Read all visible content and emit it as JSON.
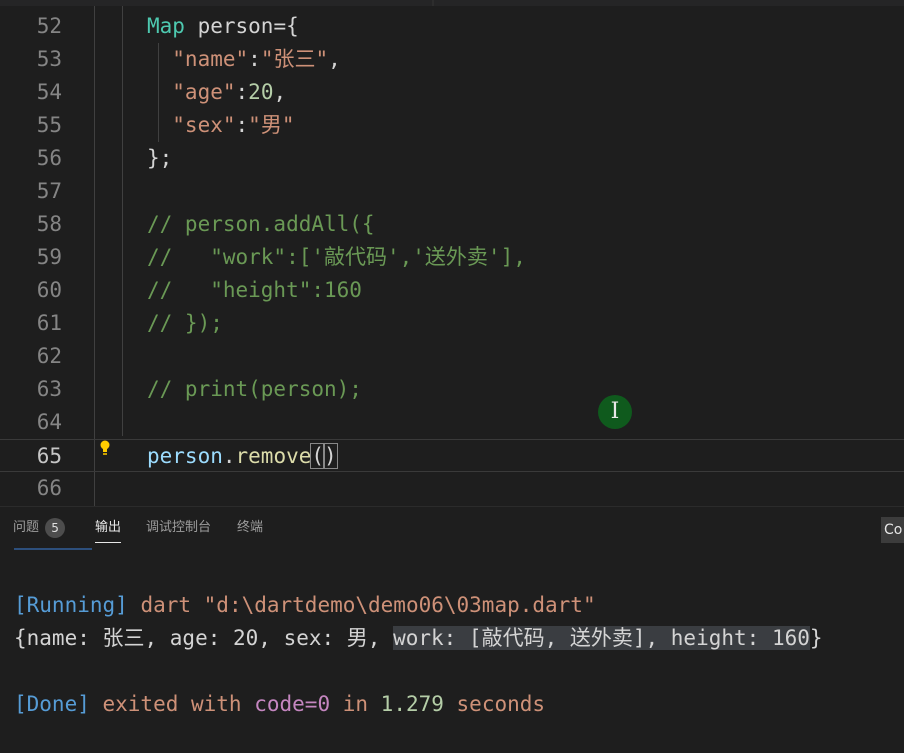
{
  "editor": {
    "lines": [
      {
        "num": "52",
        "tokens": [
          {
            "t": "Map",
            "c": "k-type"
          },
          {
            "t": " person={",
            "c": "k-punc"
          }
        ]
      },
      {
        "num": "53",
        "tokens": [
          {
            "t": "  \"name\"",
            "c": "k-str"
          },
          {
            "t": ":",
            "c": "k-punc"
          },
          {
            "t": "\"张三\"",
            "c": "k-str"
          },
          {
            "t": ",",
            "c": "k-punc"
          }
        ]
      },
      {
        "num": "54",
        "tokens": [
          {
            "t": "  \"age\"",
            "c": "k-str"
          },
          {
            "t": ":",
            "c": "k-punc"
          },
          {
            "t": "20",
            "c": "k-num"
          },
          {
            "t": ",",
            "c": "k-punc"
          }
        ]
      },
      {
        "num": "55",
        "tokens": [
          {
            "t": "  \"sex\"",
            "c": "k-str"
          },
          {
            "t": ":",
            "c": "k-punc"
          },
          {
            "t": "\"男\"",
            "c": "k-str"
          }
        ]
      },
      {
        "num": "56",
        "tokens": [
          {
            "t": "};",
            "c": "k-punc"
          }
        ]
      },
      {
        "num": "57",
        "tokens": []
      },
      {
        "num": "58",
        "tokens": [
          {
            "t": "// person.addAll({",
            "c": "k-cmt"
          }
        ]
      },
      {
        "num": "59",
        "tokens": [
          {
            "t": "//   \"work\":['敲代码','送外卖'],",
            "c": "k-cmt"
          }
        ]
      },
      {
        "num": "60",
        "tokens": [
          {
            "t": "//   \"height\":160",
            "c": "k-cmt"
          }
        ]
      },
      {
        "num": "61",
        "tokens": [
          {
            "t": "// });",
            "c": "k-cmt"
          }
        ]
      },
      {
        "num": "62",
        "tokens": []
      },
      {
        "num": "63",
        "tokens": [
          {
            "t": "// print(person);",
            "c": "k-cmt"
          }
        ]
      },
      {
        "num": "64",
        "tokens": []
      },
      {
        "num": "65",
        "current": true,
        "tokens": [
          {
            "t": "person",
            "c": "k-var"
          },
          {
            "t": ".",
            "c": "k-punc"
          },
          {
            "t": "remove",
            "c": "k-fn"
          },
          {
            "t": "(",
            "c": "k-punc paren-box"
          },
          {
            "cursor": true
          },
          {
            "t": ")",
            "c": "k-punc paren-box"
          }
        ]
      },
      {
        "num": "66",
        "tokens": []
      }
    ],
    "mouse_cursor_glyph": "I",
    "lightbulb_icon": "lightbulb-icon"
  },
  "panel": {
    "tabs": [
      {
        "label": "问题",
        "badge": "5",
        "active": false
      },
      {
        "label": "输出",
        "active": true
      },
      {
        "label": "调试控制台",
        "active": false
      },
      {
        "label": "终端",
        "active": false
      }
    ],
    "right_label": "Co"
  },
  "output": {
    "running_tag": "[Running]",
    "running_cmd": " dart \"d:\\dartdemo\\demo06\\03map.dart\"",
    "result_plain": "{name: 张三, age: 20, sex: 男, ",
    "result_selected": "work: [敲代码, 送外卖], height: 160",
    "result_end": "}",
    "done_tag": "[Done]",
    "done_exited": " exited with ",
    "done_code": "code=0",
    "done_in": " in ",
    "done_time": "1.279",
    "done_seconds": " seconds"
  }
}
